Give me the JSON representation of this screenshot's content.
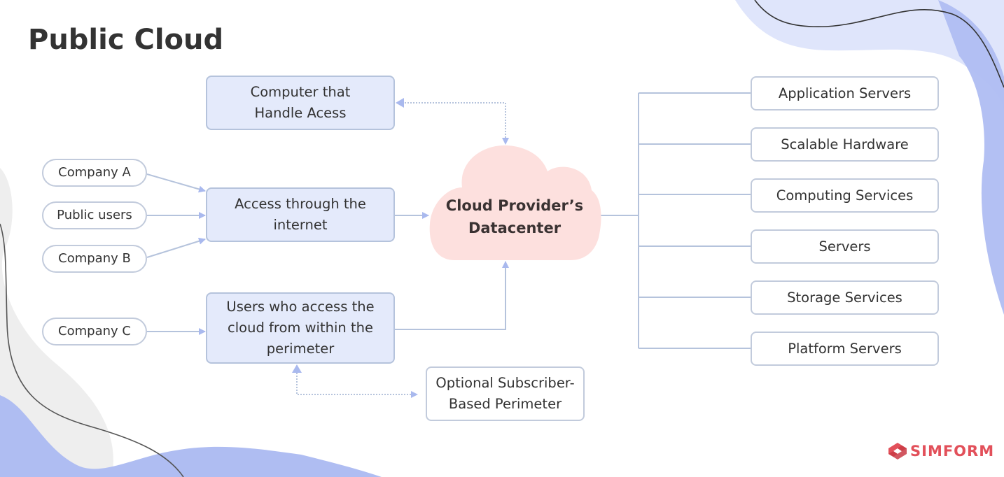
{
  "page_title": "Public Cloud",
  "center_node": {
    "line1": "Cloud Provider’s",
    "line2": "Datacenter"
  },
  "access_nodes": {
    "computer_access": {
      "line1": "Computer that",
      "line2": "Handle Acess"
    },
    "internet_access": {
      "line1": "Access through the",
      "line2": "internet"
    },
    "perimeter_users": {
      "line1": "Users who access the",
      "line2": "cloud from within the",
      "line3": "perimeter"
    },
    "optional_perimeter": {
      "line1": "Optional Subscriber-",
      "line2": "Based Perimeter"
    }
  },
  "sources": [
    "Company A",
    "Public users",
    "Company B",
    "Company C"
  ],
  "services": [
    "Application Servers",
    "Scalable Hardware",
    "Computing Services",
    "Servers",
    "Storage Services",
    "Platform Servers"
  ],
  "brand": {
    "name": "SIMFORM",
    "color": "#e2505a"
  },
  "colors": {
    "node_fill": "#e4eafb",
    "node_border": "#b5c3dc",
    "connector": "#b5c3dc",
    "arrowhead": "#a9b9ee",
    "cloud_fill": "#fde0de",
    "blob_blue": "#afbdf2",
    "blob_light": "#dfe5fb",
    "blob_gray": "#eeeeee"
  }
}
